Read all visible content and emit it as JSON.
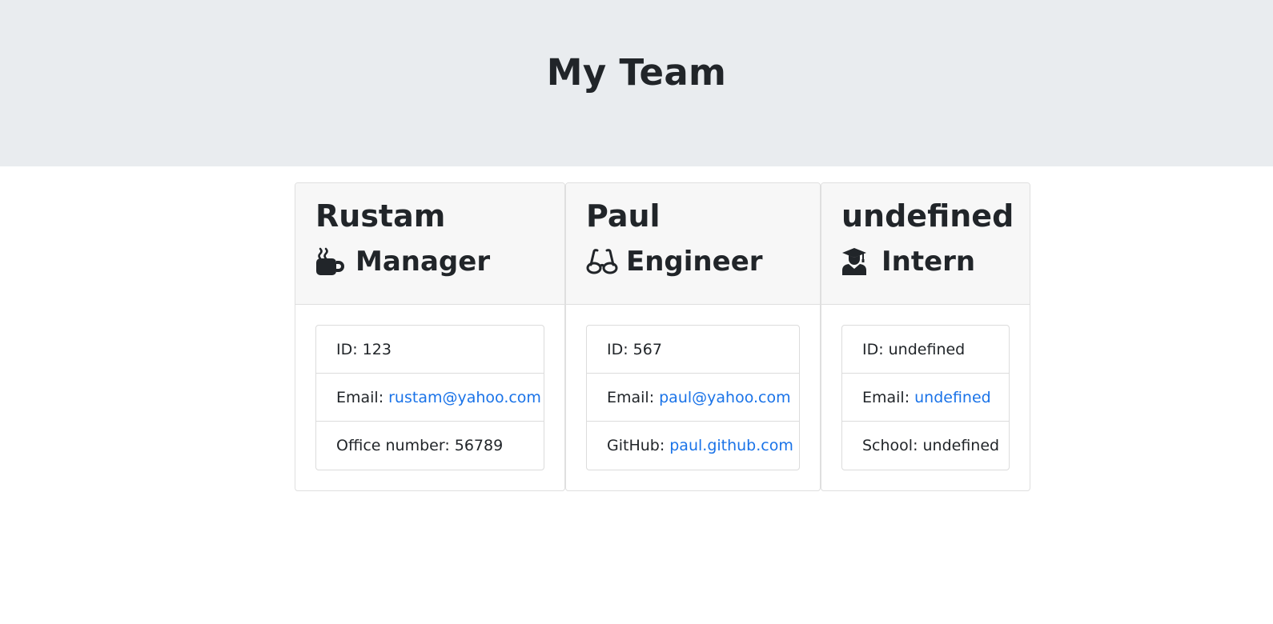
{
  "header": {
    "title": "My Team"
  },
  "employees": [
    {
      "name": "Rustam",
      "role": "Manager",
      "icon": "coffee-mug-icon",
      "id_label": "ID:",
      "id": "123",
      "email_label": "Email:",
      "email": "rustam@yahoo.com",
      "extra_label": "Office number:",
      "extra": "56789"
    },
    {
      "name": "Paul",
      "role": "Engineer",
      "icon": "glasses-icon",
      "id_label": "ID:",
      "id": "567",
      "email_label": "Email:",
      "email": "paul@yahoo.com",
      "extra_label": "GitHub:",
      "extra": "paul.github.com"
    },
    {
      "name": "undefined",
      "role": "Intern",
      "icon": "graduate-icon",
      "id_label": "ID:",
      "id": "undefined",
      "email_label": "Email:",
      "email": "undefined",
      "extra_label": "School:",
      "extra": "undefined"
    }
  ],
  "colors": {
    "header_bg": "#e9ecef",
    "link": "#1a73e8",
    "text": "#212529"
  }
}
